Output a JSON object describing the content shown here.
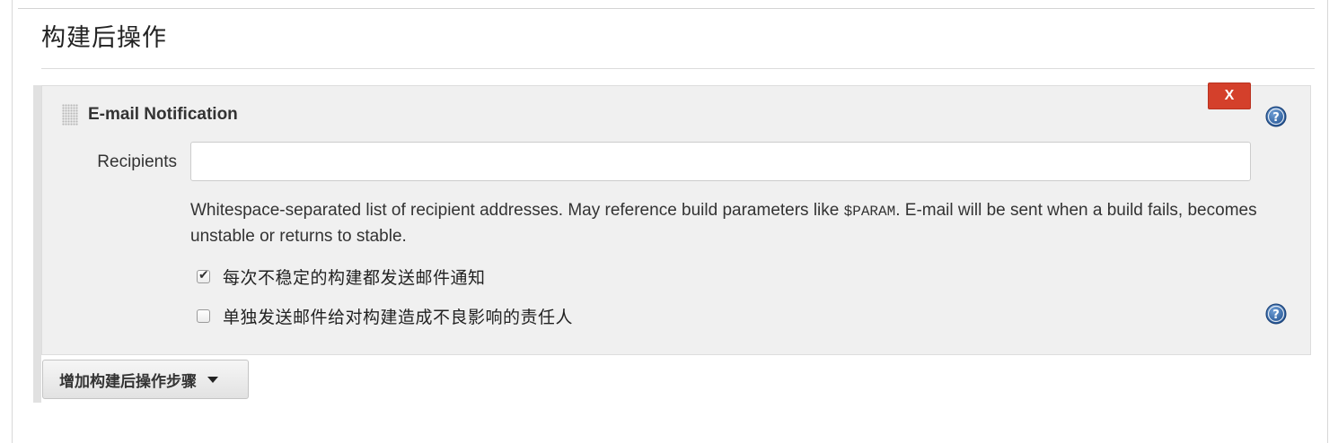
{
  "section": {
    "title": "构建后操作"
  },
  "step": {
    "title": "E-mail Notification",
    "delete_label": "X",
    "recipients": {
      "label": "Recipients",
      "value": "",
      "placeholder": ""
    },
    "help_text_before": "Whitespace-separated list of recipient addresses. May reference build parameters like ",
    "help_text_code": "$PARAM",
    "help_text_after": ". E-mail will be sent when a build fails, becomes unstable or returns to stable.",
    "options": [
      {
        "label": "每次不稳定的构建都发送邮件通知",
        "checked": true
      },
      {
        "label": "单独发送邮件给对构建造成不良影响的责任人",
        "checked": false
      }
    ]
  },
  "add_step_button": {
    "label": "增加构建后操作步骤"
  },
  "icons": {
    "help": "help-icon",
    "drag": "drag-handle-icon",
    "dropdown": "caret-down-icon"
  },
  "colors": {
    "delete_button": "#d4402b",
    "help_icon": "#2f5f9e",
    "panel_background": "#f0f0f0"
  }
}
